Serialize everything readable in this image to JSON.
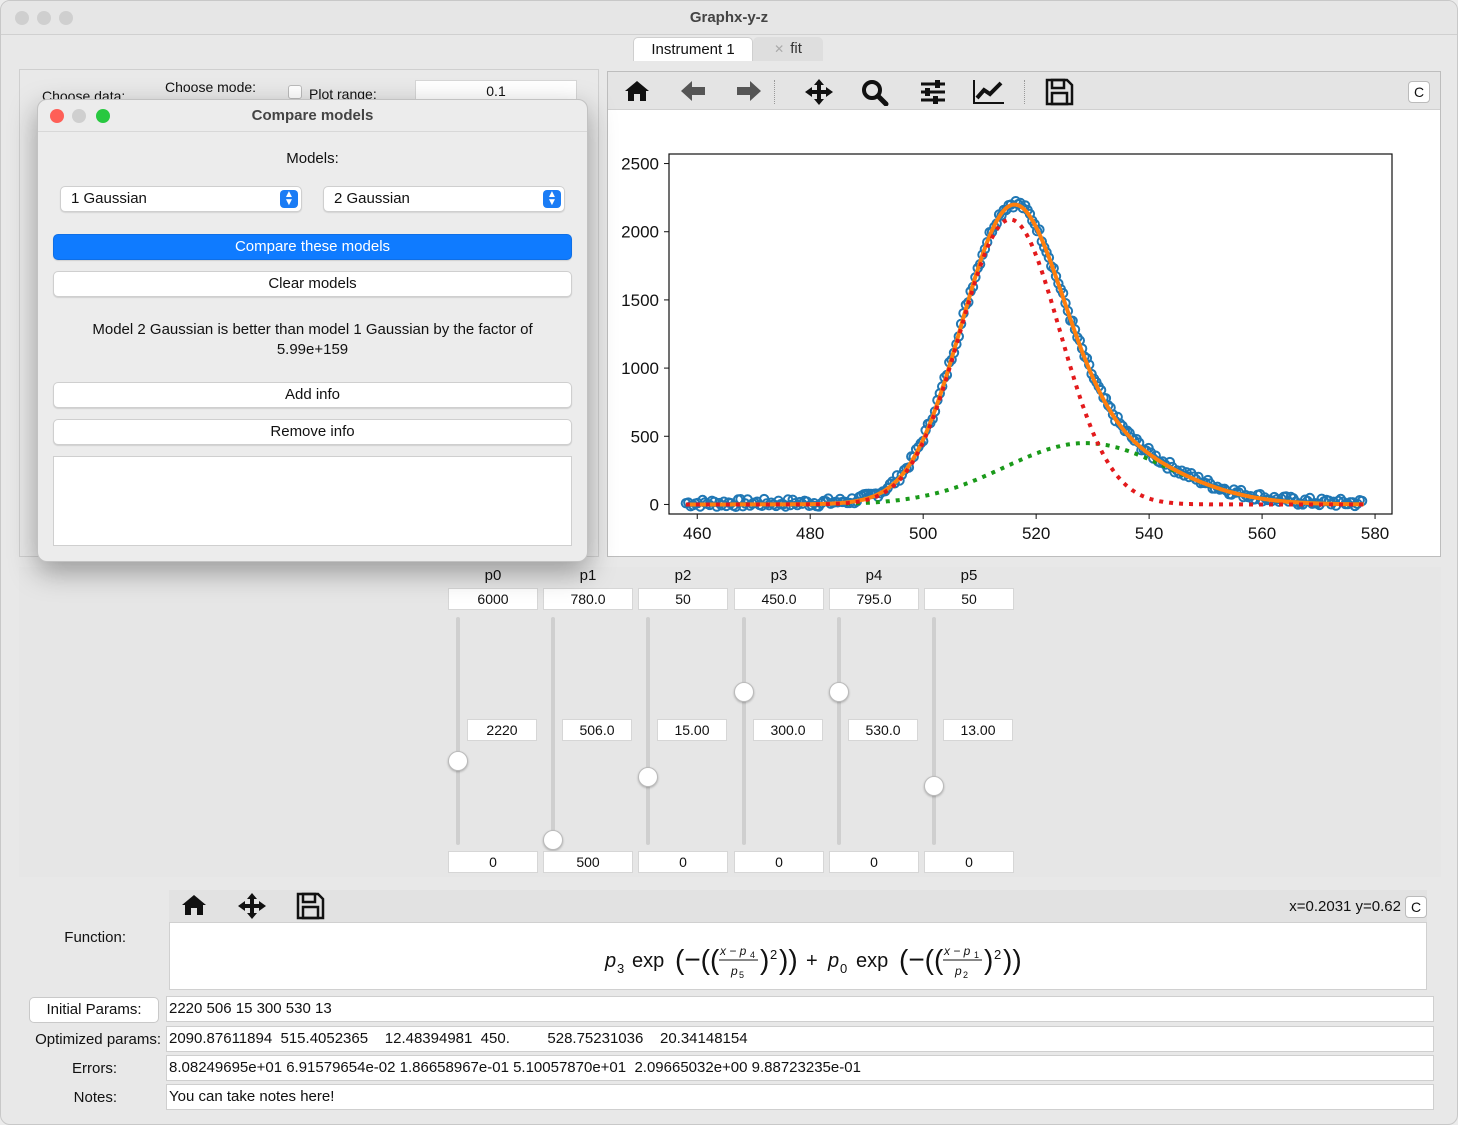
{
  "window": {
    "title": "Graphx-y-z"
  },
  "tabs": [
    {
      "label": "Instrument 1"
    },
    {
      "label": "fit"
    }
  ],
  "left_panel": {
    "choose_data_label": "Choose data:",
    "choose_mode_label": "Choose mode:",
    "plot_range_label": "Plot range:",
    "plot_range_value": "0.1"
  },
  "plot_toolbar": {
    "icons": [
      "home-icon",
      "back-arrow-icon",
      "forward-arrow-icon",
      "pan-icon",
      "zoom-icon",
      "configure-subplots-icon",
      "edit-axis-icon",
      "save-icon"
    ],
    "c_button": "C"
  },
  "chart_data": {
    "type": "line",
    "xlim": [
      455,
      583
    ],
    "ylim": [
      -70,
      2570
    ],
    "xticks": [
      "460",
      "480",
      "500",
      "520",
      "540",
      "560",
      "580"
    ],
    "yticks": [
      "0",
      "500",
      "1000",
      "1500",
      "2000",
      "2500"
    ],
    "grid": false,
    "series": [
      {
        "style": "blue circles (data)",
        "color": "#1f77b4",
        "model": {
          "gaussians": [
            [
              1900,
              515.4,
              12.5
            ],
            [
              450,
              528.75,
              20.3
            ]
          ],
          "offset": 10
        }
      },
      {
        "style": "orange solid (total fit)",
        "color": "#ff7f0e",
        "model": {
          "gaussians": [
            [
              1900,
              515.4,
              12.5
            ],
            [
              450,
              528.75,
              20.3
            ]
          ],
          "offset": 0
        }
      },
      {
        "style": "red dotted (component 1)",
        "color": "#e31a1c",
        "model": {
          "gaussians": [
            [
              2090,
              515.4,
              12.5
            ]
          ],
          "offset": 0
        }
      },
      {
        "style": "green dotted (component 2)",
        "color": "#1a9a1a",
        "model": {
          "gaussians": [
            [
              450,
              528.75,
              20.3
            ]
          ],
          "offset": 0
        }
      }
    ],
    "x_range": [
      458,
      578
    ]
  },
  "params": {
    "labels": [
      "p0",
      "p1",
      "p2",
      "p3",
      "p4",
      "p5"
    ],
    "max": [
      "6000",
      "780.0",
      "50",
      "450.0",
      "795.0",
      "50"
    ],
    "current": [
      "2220",
      "506.0",
      "15.00",
      "300.0",
      "530.0",
      "13.00"
    ],
    "min": [
      "0",
      "500",
      "0",
      "0",
      "0",
      "0"
    ],
    "slider_fraction": [
      0.37,
      0.02,
      0.3,
      0.67,
      0.67,
      0.26
    ]
  },
  "function_toolbar": {
    "icons": [
      "home-icon",
      "pan-icon",
      "save-icon"
    ],
    "coords": "x=0.2031 y=0.62",
    "c_button": "C"
  },
  "bottom": {
    "function_label": "Function:",
    "initial_params_button": "Initial Params:",
    "initial_params_value": "2220 506 15 300 530 13",
    "optimized_label": "Optimized params:",
    "optimized_value": "2090.87611894  515.4052365    12.48394981  450.         528.75231036    20.34148154",
    "errors_label": "Errors:",
    "errors_value": "8.08249695e+01 6.91579654e-02 1.86658967e-01 5.10057870e+01  2.09665032e+00 9.88723235e-01",
    "notes_label": "Notes:",
    "notes_value": "You can take notes here!"
  },
  "dialog": {
    "title": "Compare models",
    "models_label": "Models:",
    "model1": "1 Gaussian",
    "model2": "2 Gaussian",
    "compare_button": "Compare these models",
    "clear_button": "Clear models",
    "result_line1": "Model 2 Gaussian is better than model 1 Gaussian by the factor of",
    "result_line2": "5.99e+159",
    "add_info_button": "Add info",
    "remove_info_button": "Remove info",
    "info_text": ""
  }
}
